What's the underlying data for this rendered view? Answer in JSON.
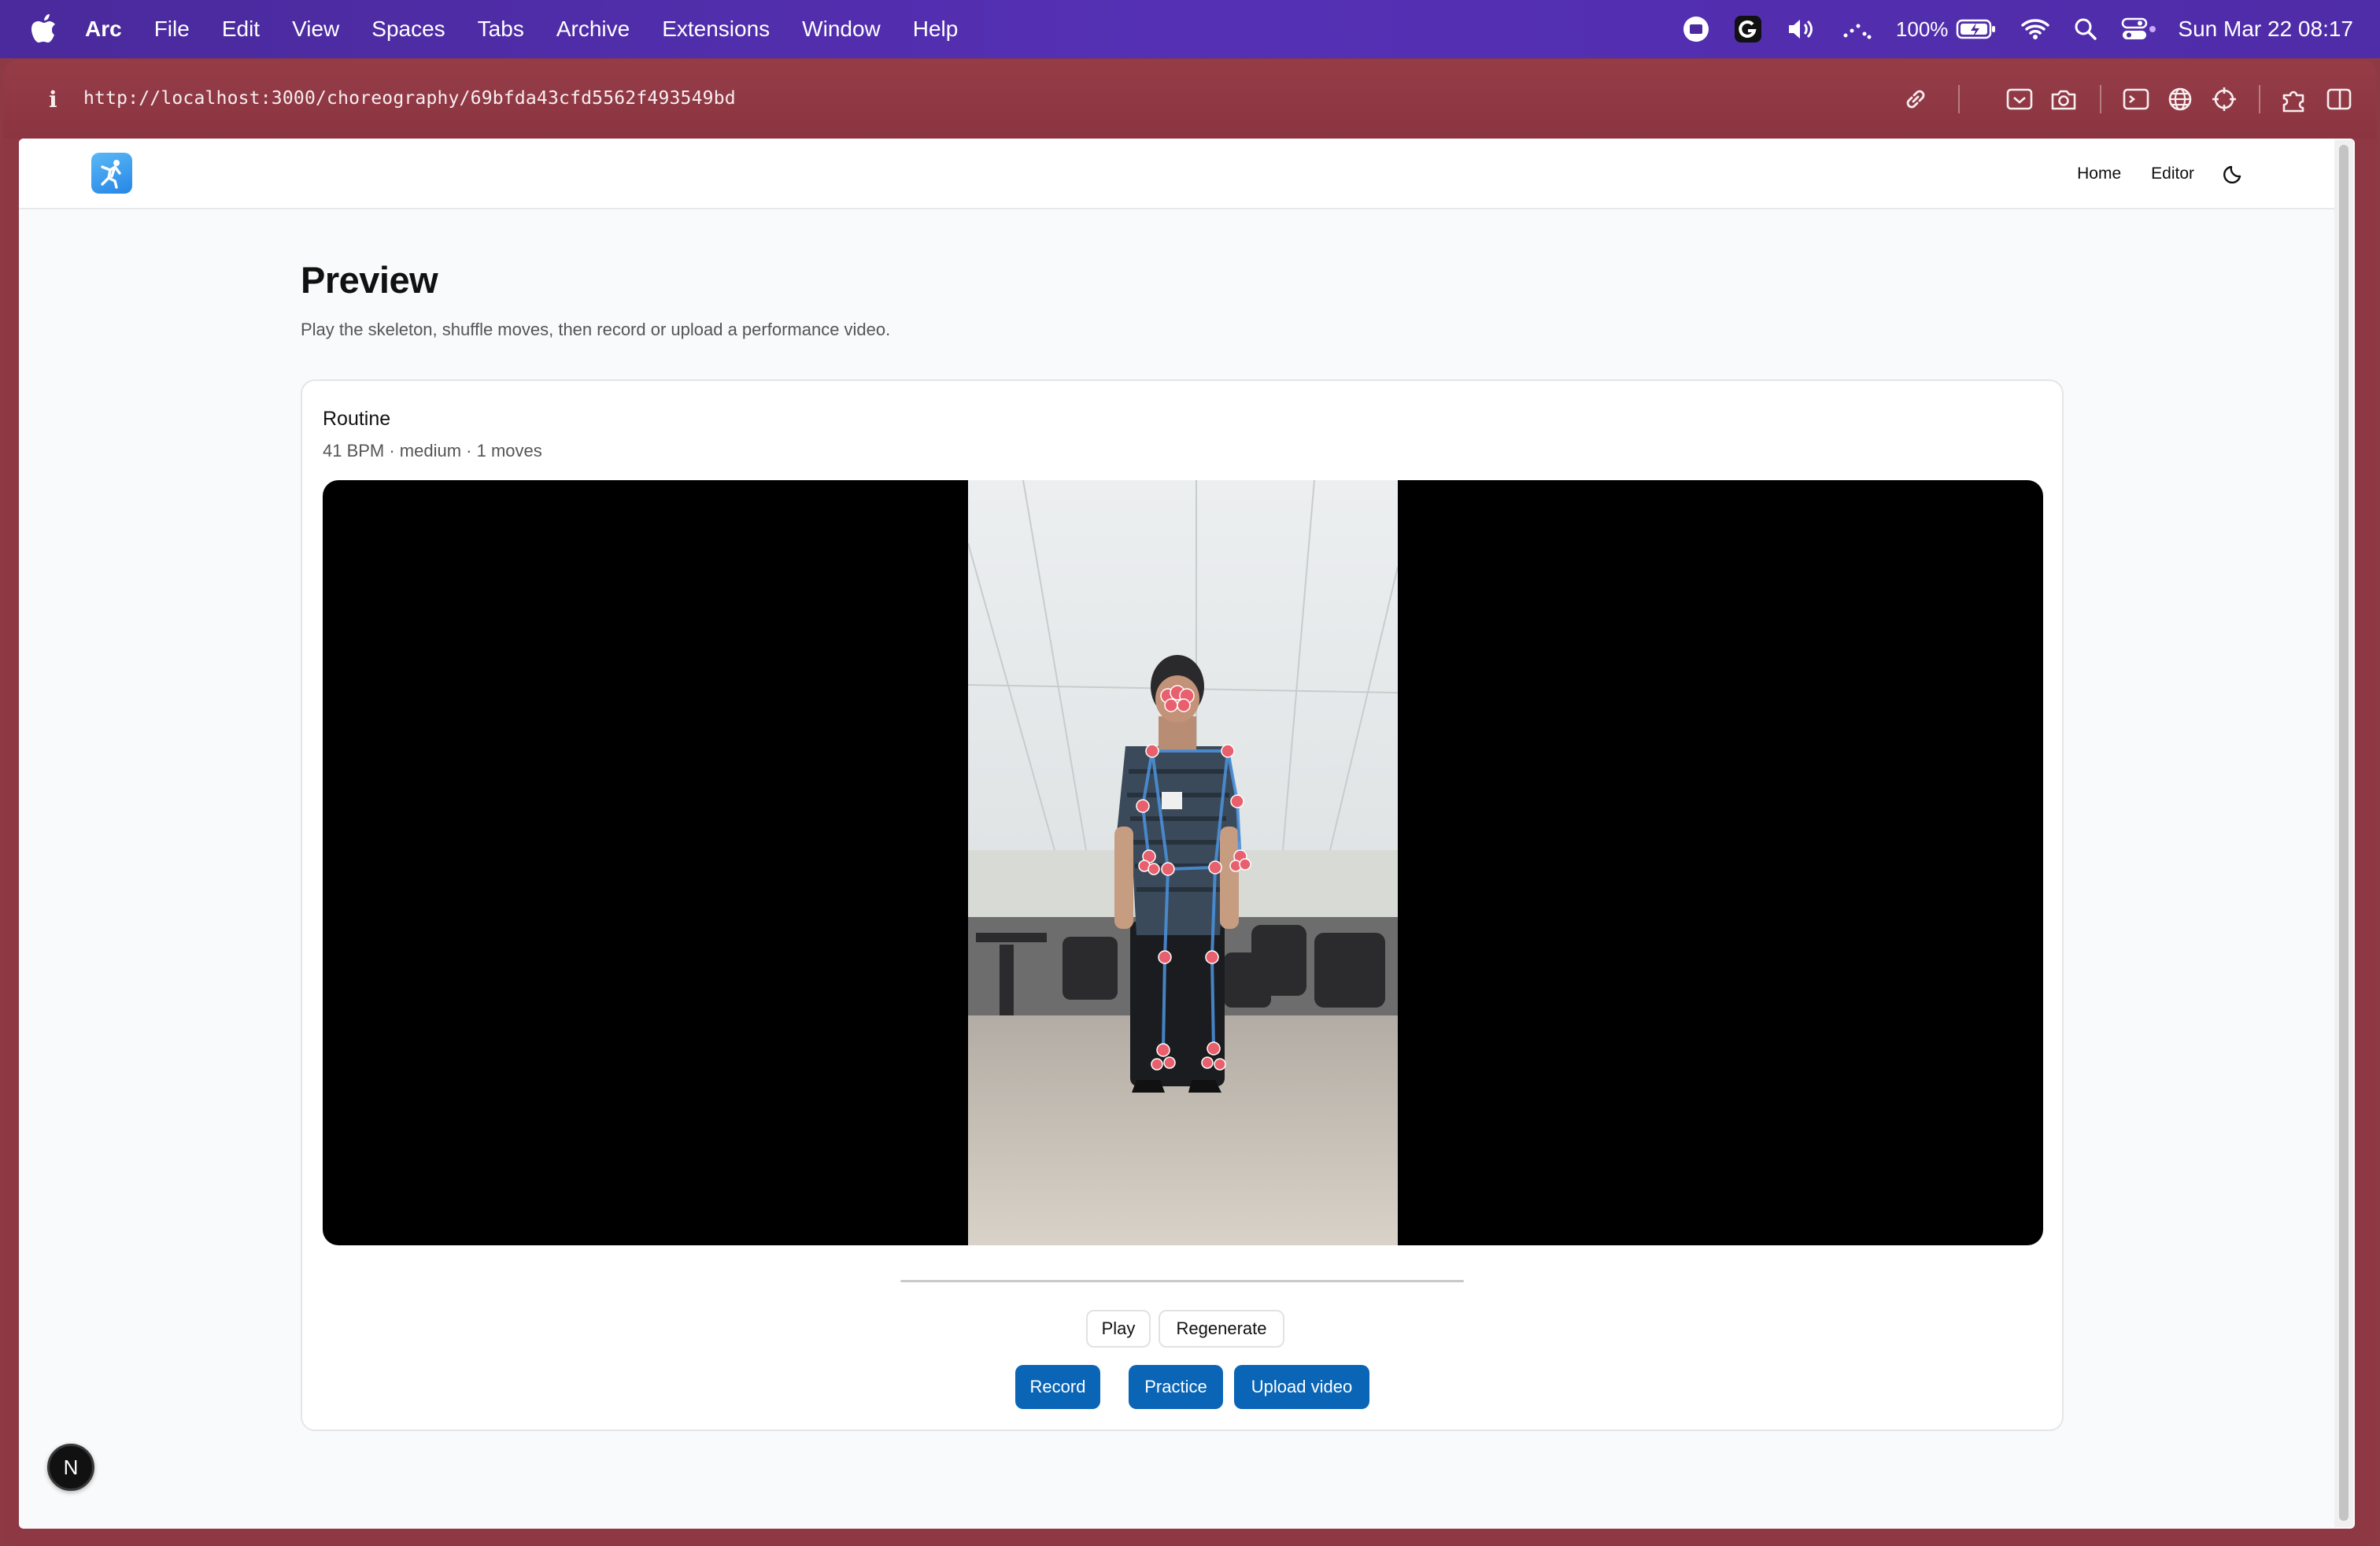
{
  "menubar": {
    "app_name": "Arc",
    "items": [
      "File",
      "Edit",
      "View",
      "Spaces",
      "Tabs",
      "Archive",
      "Extensions",
      "Window",
      "Help"
    ],
    "battery_percent": "100%",
    "clock": "Sun Mar 22  08:17"
  },
  "browser": {
    "url": "http://localhost:3000/choreography/69bfda43cfd5562f493549bd",
    "info_glyph": "i",
    "accent_color": "#8e3843"
  },
  "site": {
    "nav": {
      "home": "Home",
      "editor": "Editor"
    }
  },
  "page": {
    "title": "Preview",
    "subtitle": "Play the skeleton, shuffle moves, then record or upload a performance video."
  },
  "routine": {
    "title": "Routine",
    "meta": "41 BPM · medium · 1 moves",
    "playback_progress": 0.0
  },
  "actions": {
    "play": "Play",
    "regenerate": "Regenerate",
    "record": "Record",
    "practice": "Practice",
    "upload": "Upload video",
    "primary_color": "#0a65b6"
  },
  "dev_badge": {
    "letter": "N"
  }
}
